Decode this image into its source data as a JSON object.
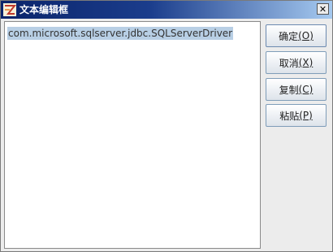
{
  "window": {
    "title": "文本编辑框",
    "close_label": "✕"
  },
  "editor": {
    "content": "com.microsoft.sqlserver.jdbc.SQLServerDriver"
  },
  "buttons": [
    {
      "label": "确定",
      "mnemonic": "(O)"
    },
    {
      "label": "取消",
      "mnemonic": "(X)"
    },
    {
      "label": "复制",
      "mnemonic": "(C)"
    },
    {
      "label": "粘贴",
      "mnemonic": "(P)"
    }
  ],
  "colors": {
    "titlebar_start": "#0a246a",
    "titlebar_end": "#a6caf0",
    "selection": "#b8cfe5"
  }
}
